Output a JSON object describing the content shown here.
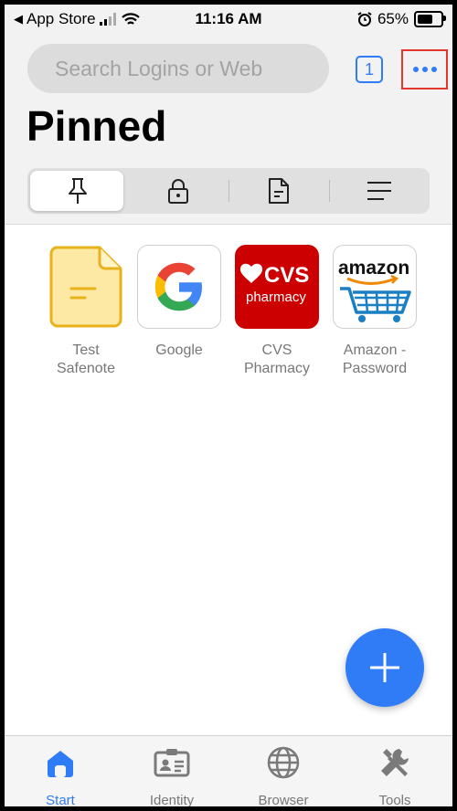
{
  "status_bar": {
    "carrier": "App Store",
    "time": "11:16 AM",
    "battery": "65%",
    "battery_level": 0.65
  },
  "search": {
    "placeholder": "Search Logins or Web"
  },
  "header": {
    "tab_count": "1",
    "title": "Pinned"
  },
  "segments": [
    {
      "icon": "pin-icon",
      "selected": true
    },
    {
      "icon": "lock-icon",
      "selected": false
    },
    {
      "icon": "note-icon",
      "selected": false
    },
    {
      "icon": "list-icon",
      "selected": false
    }
  ],
  "pinned_items": [
    {
      "label": "Test Safenote",
      "icon": "note-icon"
    },
    {
      "label": "Google",
      "icon": "google-logo-icon"
    },
    {
      "label": "CVS Pharmacy",
      "icon": "cvs-logo-icon",
      "logo_text": "CVS pharmacy"
    },
    {
      "label": "Amazon - Password",
      "icon": "amazon-logo-icon",
      "logo_text": "amazon"
    }
  ],
  "tabbar": [
    {
      "label": "Start",
      "icon": "home-icon",
      "active": true
    },
    {
      "label": "Identity",
      "icon": "id-card-icon",
      "active": false
    },
    {
      "label": "Browser",
      "icon": "globe-icon",
      "active": false
    },
    {
      "label": "Tools",
      "icon": "tools-icon",
      "active": false
    }
  ],
  "colors": {
    "accent": "#2f7cf6",
    "highlight_border": "#e2352b",
    "cvs_red": "#cc0000",
    "note_yellow": "#fde9a3",
    "note_border": "#e8b21c"
  }
}
